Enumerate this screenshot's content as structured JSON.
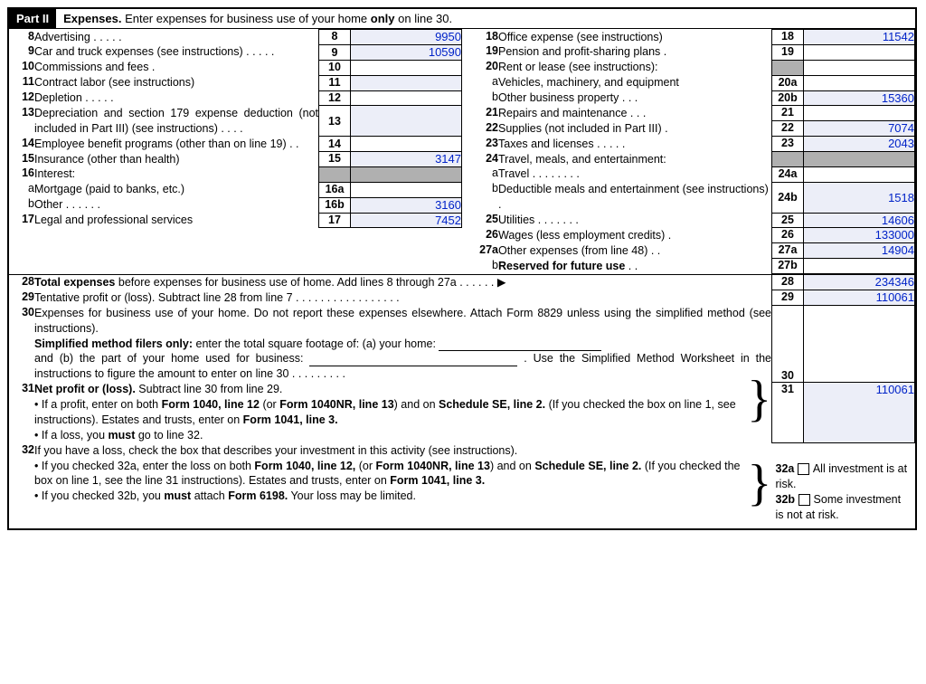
{
  "part": {
    "badge": "Part II",
    "title_a": "Expenses.",
    "title_b": " Enter expenses for business use of your home ",
    "title_bold": "only",
    "title_c": " on line 30."
  },
  "left": {
    "l8": {
      "n": "8",
      "d": "Advertising .    .    .    .    .",
      "b": "8",
      "v": "9950"
    },
    "l9": {
      "n": "9",
      "d": "Car and truck expenses (see instructions) .    .    .    .    .",
      "b": "9",
      "v": "10590"
    },
    "l10": {
      "n": "10",
      "d": "Commissions and fees    .",
      "b": "10",
      "v": ""
    },
    "l11": {
      "n": "11",
      "d": "Contract labor (see instructions)",
      "b": "11",
      "v": ""
    },
    "l12": {
      "n": "12",
      "d": "Depletion    .    .    .    .    .",
      "b": "12",
      "v": ""
    },
    "l13": {
      "n": "13",
      "d": "Depreciation and section 179 expense deduction (not included in Part III) (see instructions) .    .    .    .",
      "b": "13",
      "v": ""
    },
    "l14": {
      "n": "14",
      "d": "Employee benefit programs (other than on line 19) .    .",
      "b": "14",
      "v": ""
    },
    "l15": {
      "n": "15",
      "d": "Insurance (other than health)",
      "b": "15",
      "v": "3147"
    },
    "l16": {
      "n": "16",
      "d": "Interest:"
    },
    "l16a": {
      "n": "a",
      "d": "Mortgage (paid to banks, etc.)",
      "b": "16a",
      "v": ""
    },
    "l16b": {
      "n": "b",
      "d": "Other    .    .    .    .    .    .",
      "b": "16b",
      "v": "3160"
    },
    "l17": {
      "n": "17",
      "d": "Legal and professional services",
      "b": "17",
      "v": "7452"
    }
  },
  "right": {
    "l18": {
      "n": "18",
      "d": "Office expense (see instructions)",
      "b": "18",
      "v": "11542"
    },
    "l19": {
      "n": "19",
      "d": "Pension and profit-sharing plans    .",
      "b": "19",
      "v": ""
    },
    "l20": {
      "n": "20",
      "d": "Rent or lease (see instructions):"
    },
    "l20a": {
      "n": "a",
      "d": "Vehicles, machinery, and equipment",
      "b": "20a",
      "v": ""
    },
    "l20b": {
      "n": "b",
      "d": "Other business property    .    .    .",
      "b": "20b",
      "v": "15360"
    },
    "l21": {
      "n": "21",
      "d": "Repairs and maintenance .    .    .",
      "b": "21",
      "v": ""
    },
    "l22": {
      "n": "22",
      "d": "Supplies (not included in Part III)   .",
      "b": "22",
      "v": "7074"
    },
    "l23": {
      "n": "23",
      "d": "Taxes and licenses .    .    .    .    .",
      "b": "23",
      "v": "2043"
    },
    "l24": {
      "n": "24",
      "d": "Travel, meals, and entertainment:"
    },
    "l24a": {
      "n": "a",
      "d": "Travel .    .    .    .    .    .    .    .",
      "b": "24a",
      "v": ""
    },
    "l24b": {
      "n": "b",
      "d": "Deductible meals and entertainment (see instructions)    .",
      "b": "24b",
      "v": "1518"
    },
    "l25": {
      "n": "25",
      "d": "Utilities    .    .    .    .    .    .    .",
      "b": "25",
      "v": "14606"
    },
    "l26": {
      "n": "26",
      "d": "Wages (less employment credits) .",
      "b": "26",
      "v": "133000"
    },
    "l27a": {
      "n": "27a",
      "d": "Other expenses (from line 48)   .    .",
      "b": "27a",
      "v": "14904"
    },
    "l27b": {
      "n": "b",
      "d_a": "Reserved for future use",
      "d_b": "   .    .",
      "b": "27b",
      "v": ""
    }
  },
  "bottom": {
    "l28": {
      "n": "28",
      "d": "Total expenses",
      "d2": " before expenses for business use of home. Add lines 8 through 27a    .    .    .    .    .    .   ▶",
      "b": "28",
      "v": "234346"
    },
    "l29": {
      "n": "29",
      "d": "Tentative profit or (loss). Subtract line 28 from line 7   .    .    .    .    .    .    .    .    .    .    .    .    .    .    .    .    .",
      "b": "29",
      "v": "110061"
    },
    "l30": {
      "n": "30",
      "p1": "Expenses for business use of your home. Do not report these expenses elsewhere. Attach Form 8829 unless using the simplified method (see instructions).",
      "p2a": "Simplified method filers only:",
      "p2b": " enter the total square footage of: (a) your home: ",
      "p3a": "and (b) the part of your home used for business: ",
      "p3b": " . Use the Simplified Method Worksheet in the instructions to figure the amount to enter on line 30    .    .    .    .    .    .    .    .    .",
      "b": "30",
      "v": ""
    },
    "l31": {
      "n": "31",
      "t": "Net profit or (loss).",
      "t2": "  Subtract line 30 from line 29.",
      "bul1a": "•  If a profit, enter on both ",
      "bul1b": "Form 1040, line 12",
      "bul1c": " (or ",
      "bul1d": "Form 1040NR, line 13",
      "bul1e": ") and on ",
      "bul1f": "Schedule SE, line 2.",
      "bul1g": " (If you checked the box on line 1, see instructions). Estates and trusts, enter on ",
      "bul1h": "Form 1041, line 3.",
      "bul2a": "•  If a loss, you ",
      "bul2b": "must ",
      "bul2c": " go to line 32.",
      "b": "31",
      "v": "110061"
    },
    "l32": {
      "n": "32",
      "p1": "If you have a loss, check the box that describes your investment in this activity (see instructions).",
      "bul1a": "•  If you checked 32a, enter the loss on both ",
      "bul1b": "Form 1040, line 12,",
      "bul1c": " (or ",
      "bul1d": "Form 1040NR, line 13",
      "bul1e": ") and on ",
      "bul1f": "Schedule SE, line 2.",
      "bul1g": " (If you checked the box on line 1, see the line 31 instructions). Estates and trusts, enter on ",
      "bul1h": "Form 1041, line 3.",
      "bul2a": "•  If you checked 32b, you ",
      "bul2b": "must",
      "bul2c": " attach ",
      "bul2d": "Form 6198.",
      "bul2e": " Your loss may be limited.",
      "c32a_b": "32a",
      "c32a_t": "All investment is at risk.",
      "c32b_b": "32b",
      "c32b_t": "Some investment is not at risk."
    }
  }
}
